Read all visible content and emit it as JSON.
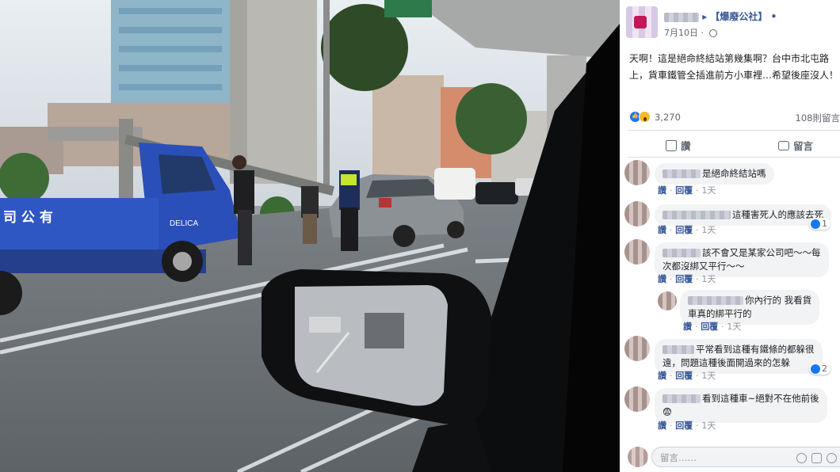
{
  "post": {
    "page_name": "【爆廢公社】",
    "date": "7月10日",
    "text_line1": "天啊！這是絕命終結站第幾集啊？台中市北屯路",
    "text_line2": "上，貨車鐵管全插進前方小車裡…希望後座沒人！",
    "reaction_count": "3,270",
    "comment_count": "108則留言"
  },
  "actions": {
    "like_label": "讚",
    "comment_label": "留言"
  },
  "comments": [
    {
      "text": "是絕命終結站嗎",
      "like": "讚",
      "reply": "回覆",
      "time": "1天"
    },
    {
      "text": "這種害死人的應該去死",
      "like": "讚",
      "reply": "回覆",
      "time": "1天",
      "reactions": "1"
    },
    {
      "text_line1": "該不會又是某家公司吧～～每",
      "text_line2": "次都沒綁又平行～～",
      "like": "讚",
      "reply": "回覆",
      "time": "1天"
    },
    {
      "text_line1": "你內行的 我看貨",
      "text_line2": "車真的綁平行的",
      "like": "讚",
      "reply": "回覆",
      "time": "1天"
    },
    {
      "text_line1": "平常看到這種有鐵條的都躲很",
      "text_line2": "遠，問題這種後面開過來的怎躲",
      "like": "讚",
      "reply": "回覆",
      "time": "1天",
      "reactions": "2"
    },
    {
      "text_line1": "看到這種車~絕對不在他前後",
      "text_line2": "😨",
      "like": "讚",
      "reply": "回覆",
      "time": "1天"
    }
  ],
  "input": {
    "placeholder": "留言……"
  },
  "photo": {
    "sign_text": "司 公 有",
    "truck_brand": "DELICA"
  },
  "colors": {
    "fb_blue": "#385898",
    "like_blue": "#1877f2",
    "bubble_bg": "#f2f3f5",
    "truck_blue": "#2b4fb8"
  },
  "icons": [
    "globe-icon",
    "like-reaction-icon",
    "wow-reaction-icon",
    "thumbs-up-icon",
    "comment-bubble-icon",
    "emoji-icon",
    "camera-icon",
    "gif-icon",
    "sticker-icon"
  ]
}
